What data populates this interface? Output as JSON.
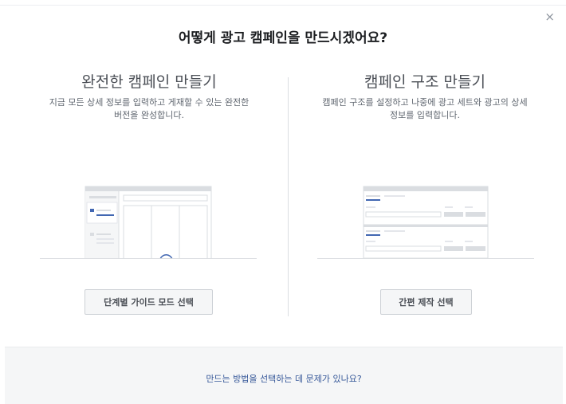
{
  "dialog": {
    "title": "어떻게 광고 캠페인을 만드시겠어요?",
    "close_label": "×"
  },
  "options": [
    {
      "title": "완전한 캠페인 만들기",
      "description": "지금 모든 상세 정보를 입력하고 게재할 수 있는 완전한 버전을 완성합니다.",
      "button_label": "단계별 가이드 모드 선택"
    },
    {
      "title": "캠페인 구조 만들기",
      "description": "캠페인 구조를 설정하고 나중에 광고 세트와 광고의 상세 정보를 입력합니다.",
      "button_label": "간편 제작 선택"
    }
  ],
  "footer": {
    "help_link": "만드는 방법을 선택하는 데 문제가 있나요?"
  },
  "colors": {
    "accent": "#4267b2",
    "link": "#365899",
    "button_bg": "#f5f6f7",
    "border": "#ccd0d5"
  }
}
